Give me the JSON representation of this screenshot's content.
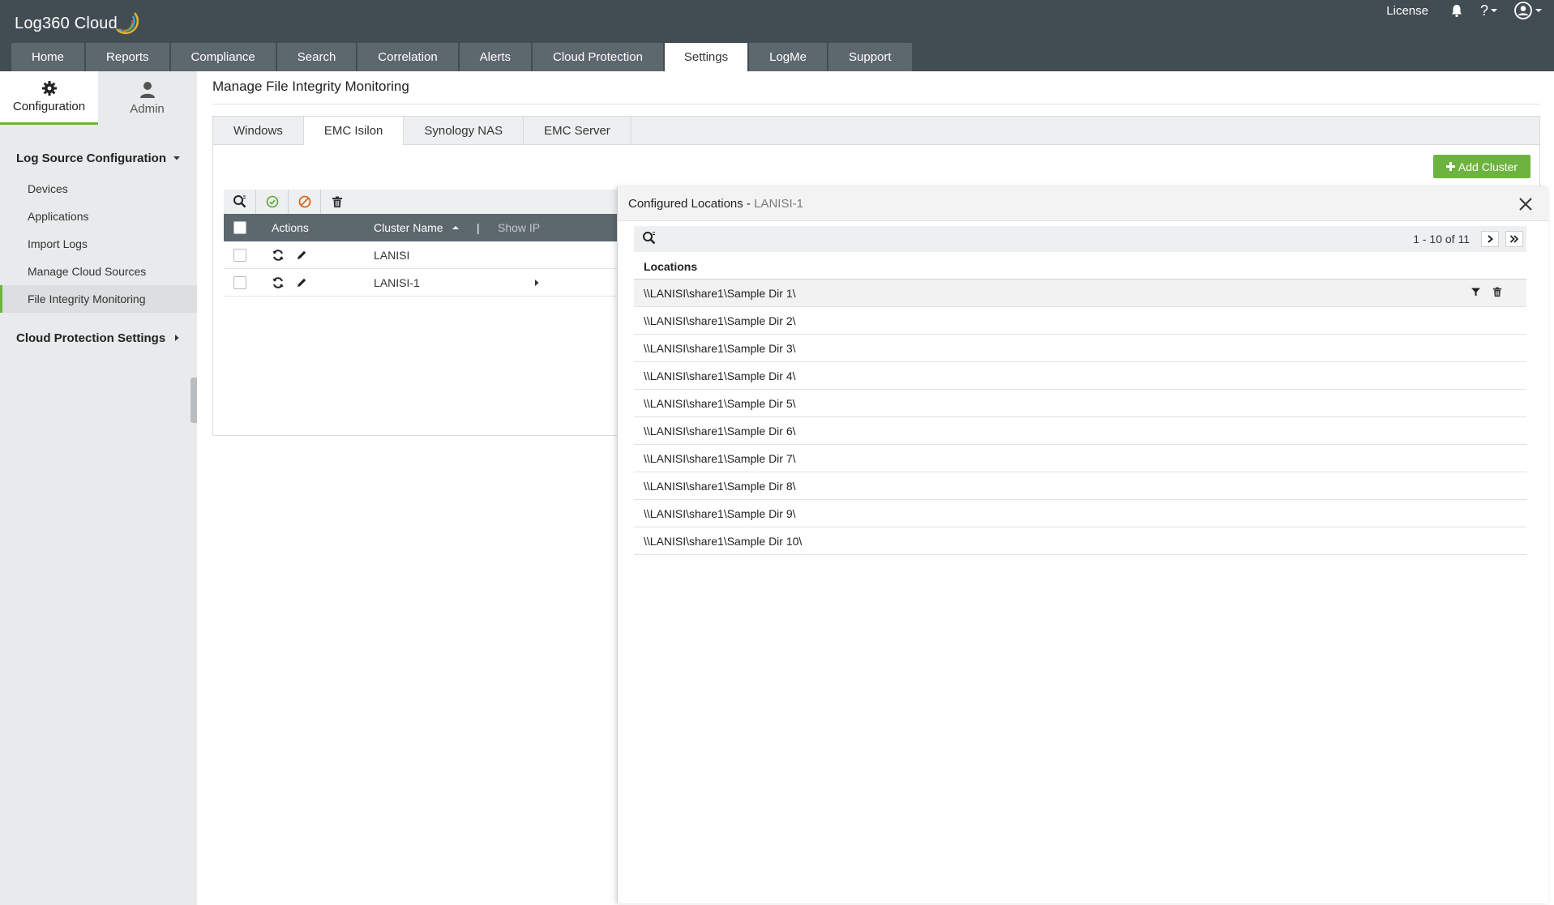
{
  "app": {
    "logo_text": "Log360 Cloud"
  },
  "header": {
    "license_label": "License",
    "help_label": "?",
    "nav_tabs": [
      {
        "label": "Home"
      },
      {
        "label": "Reports"
      },
      {
        "label": "Compliance"
      },
      {
        "label": "Search"
      },
      {
        "label": "Correlation"
      },
      {
        "label": "Alerts"
      },
      {
        "label": "Cloud Protection"
      },
      {
        "label": "Settings",
        "active": true
      },
      {
        "label": "LogMe"
      },
      {
        "label": "Support"
      }
    ]
  },
  "sidebar": {
    "tabs": [
      {
        "label": "Configuration",
        "icon": "gear-icon",
        "active": true
      },
      {
        "label": "Admin",
        "icon": "user-icon"
      }
    ],
    "group1": "Log Source Configuration",
    "items": [
      {
        "label": "Devices"
      },
      {
        "label": "Applications"
      },
      {
        "label": "Import Logs"
      },
      {
        "label": "Manage Cloud Sources"
      },
      {
        "label": "File Integrity Monitoring",
        "active": true
      }
    ],
    "group2": "Cloud Protection Settings"
  },
  "main": {
    "title": "Manage File Integrity Monitoring",
    "subtabs": [
      {
        "label": "Windows"
      },
      {
        "label": "EMC Isilon",
        "active": true
      },
      {
        "label": "Synology NAS"
      },
      {
        "label": "EMC Server"
      }
    ],
    "add_cluster_label": "Add Cluster",
    "grid": {
      "col_actions": "Actions",
      "col_cluster": "Cluster Name",
      "col_separator": "|",
      "col_show_ip": "Show IP",
      "rows": [
        {
          "cluster": "LANISI"
        },
        {
          "cluster": "LANISI-1"
        }
      ]
    }
  },
  "panel": {
    "title": "Configured Locations - ",
    "subtitle": "LANISI-1",
    "pager_text": "1 - 10 of 11",
    "column": "Locations",
    "locations": [
      "\\\\LANISI\\share1\\Sample Dir 1\\",
      "\\\\LANISI\\share1\\Sample Dir 2\\",
      "\\\\LANISI\\share1\\Sample Dir 3\\",
      "\\\\LANISI\\share1\\Sample Dir 4\\",
      "\\\\LANISI\\share1\\Sample Dir 5\\",
      "\\\\LANISI\\share1\\Sample Dir 6\\",
      "\\\\LANISI\\share1\\Sample Dir 7\\",
      "\\\\LANISI\\share1\\Sample Dir 8\\",
      "\\\\LANISI\\share1\\Sample Dir 9\\",
      "\\\\LANISI\\share1\\Sample Dir 10\\"
    ]
  },
  "colors": {
    "header_bg": "#424c53",
    "nav_tab_bg": "#5d676e",
    "accent_green": "#6db33f",
    "sidebar_bg": "#e9eaeb"
  }
}
